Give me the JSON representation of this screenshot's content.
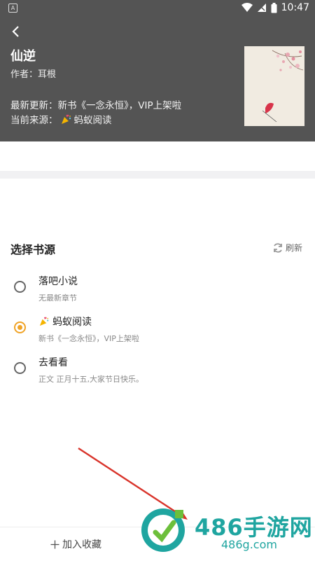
{
  "status": {
    "app_icon": "A",
    "time": "10:47"
  },
  "book": {
    "title": "仙逆",
    "author": "作者：耳根",
    "latest": "最新更新：新书《一念永恒》，VIP上架啦",
    "source_label": "当前来源：",
    "source_name": "蚂蚁阅读"
  },
  "sources": {
    "title": "选择书源",
    "refresh_label": "刷新",
    "items": [
      {
        "name": "落吧小说",
        "sub": "无最新章节",
        "checked": false
      },
      {
        "name": "蚂蚁阅读",
        "sub": "新书《一念永恒》，VIP上架啦",
        "checked": true
      },
      {
        "name": "去看看",
        "sub": "正文 正月十五,大家节日快乐。",
        "checked": false
      }
    ]
  },
  "bottom": {
    "add_favorite": "加入收藏"
  },
  "watermark": {
    "text": "486手游网",
    "sub": "486g.com"
  },
  "colors": {
    "header_bg": "#545454",
    "accent": "#f0a326",
    "watermark": "#1fa5a0"
  }
}
